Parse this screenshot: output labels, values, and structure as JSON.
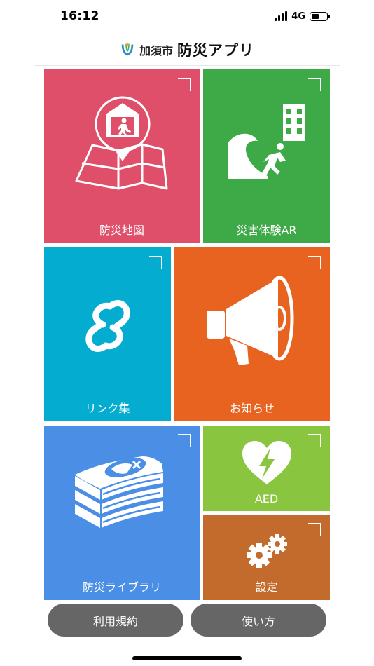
{
  "status_bar": {
    "time": "16:12",
    "network": "4G",
    "battery_level": 0.5
  },
  "header": {
    "city_name": "加須市",
    "app_name": "防災アプリ",
    "logo_icon": "city-emblem-icon"
  },
  "tiles": {
    "map": {
      "label": "防災地図",
      "color": "#df4f69",
      "icon": "evacuation-map-icon"
    },
    "ar": {
      "label": "災害体験AR",
      "color": "#3daa47",
      "icon": "tsunami-escape-icon"
    },
    "links": {
      "label": "リンク集",
      "color": "#04add0",
      "icon": "chain-link-icon"
    },
    "news": {
      "label": "お知らせ",
      "color": "#e7631f",
      "icon": "megaphone-icon"
    },
    "library": {
      "label": "防災ライブラリ",
      "color": "#4a8ee5",
      "icon": "book-stack-icon"
    },
    "aed": {
      "label": "AED",
      "color": "#8ac53f",
      "icon": "aed-heart-icon"
    },
    "settings": {
      "label": "設定",
      "color": "#c36b2c",
      "icon": "gears-icon"
    }
  },
  "buttons": {
    "terms": "利用規約",
    "how_to_use": "使い方"
  }
}
